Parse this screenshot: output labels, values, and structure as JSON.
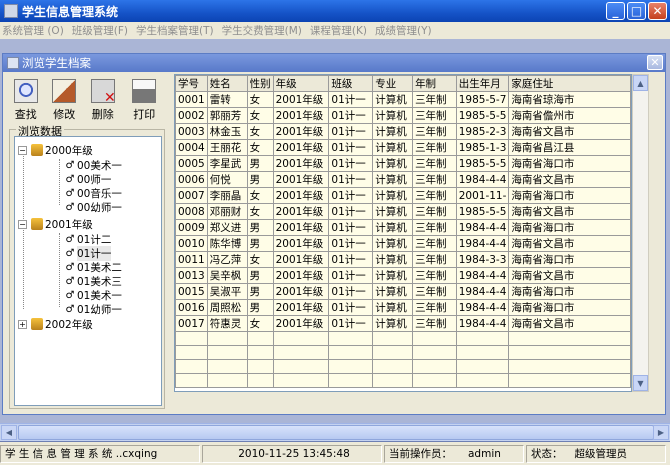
{
  "window": {
    "title": "学生信息管理系统"
  },
  "menu": [
    "系统管理 (O)",
    "班级管理(F)",
    "学生档案管理(T)",
    "学生交费管理(M)",
    "课程管理(K)",
    "成绩管理(Y)"
  ],
  "child": {
    "title": "浏览学生档案"
  },
  "toolbar": {
    "find": "查找",
    "edit": "修改",
    "delete": "删除",
    "print": "打印"
  },
  "tree": {
    "group_label": "浏览数据",
    "y2000": {
      "label": "2000年级",
      "classes": [
        "00美术一",
        "00师一",
        "00音乐一",
        "00幼师一"
      ]
    },
    "y2001": {
      "label": "2001年级",
      "classes": [
        "01计二",
        "01计一",
        "01美术二",
        "01美术三",
        "01美术一",
        "01幼师一"
      ]
    },
    "y2002": {
      "label": "2002年级"
    }
  },
  "table": {
    "headers": [
      "学号",
      "姓名",
      "性别",
      "年级",
      "班级",
      "专业",
      "年制",
      "出生年月",
      "家庭住址"
    ],
    "rows": [
      [
        "0001",
        "雷转",
        "女",
        "2001年级",
        "01计一",
        "计算机",
        "三年制",
        "1985-5-7",
        "海南省琼海市"
      ],
      [
        "0002",
        "郭丽芳",
        "女",
        "2001年级",
        "01计一",
        "计算机",
        "三年制",
        "1985-5-5",
        "海南省儋州市"
      ],
      [
        "0003",
        "林金玉",
        "女",
        "2001年级",
        "01计一",
        "计算机",
        "三年制",
        "1985-2-3",
        "海南省文昌市"
      ],
      [
        "0004",
        "王丽花",
        "女",
        "2001年级",
        "01计一",
        "计算机",
        "三年制",
        "1985-1-3",
        "海南省昌江县"
      ],
      [
        "0005",
        "李星武",
        "男",
        "2001年级",
        "01计一",
        "计算机",
        "三年制",
        "1985-5-5",
        "海南省海口市"
      ],
      [
        "0006",
        "何悦",
        "男",
        "2001年级",
        "01计一",
        "计算机",
        "三年制",
        "1984-4-4",
        "海南省文昌市"
      ],
      [
        "0007",
        "李丽晶",
        "女",
        "2001年级",
        "01计一",
        "计算机",
        "三年制",
        "2001-11-",
        "海南省海口市"
      ],
      [
        "0008",
        "邓丽财",
        "女",
        "2001年级",
        "01计一",
        "计算机",
        "三年制",
        "1985-5-5",
        "海南省文昌市"
      ],
      [
        "0009",
        "郑义进",
        "男",
        "2001年级",
        "01计一",
        "计算机",
        "三年制",
        "1984-4-4",
        "海南省海口市"
      ],
      [
        "0010",
        "陈华博",
        "男",
        "2001年级",
        "01计一",
        "计算机",
        "三年制",
        "1984-4-4",
        "海南省文昌市"
      ],
      [
        "0011",
        "冯乙萍",
        "女",
        "2001年级",
        "01计一",
        "计算机",
        "三年制",
        "1984-3-3",
        "海南省海口市"
      ],
      [
        "0013",
        "吴辛枫",
        "男",
        "2001年级",
        "01计一",
        "计算机",
        "三年制",
        "1984-4-4",
        "海南省文昌市"
      ],
      [
        "0015",
        "吴淑平",
        "男",
        "2001年级",
        "01计一",
        "计算机",
        "三年制",
        "1984-4-4",
        "海南省海口市"
      ],
      [
        "0016",
        "周照松",
        "男",
        "2001年级",
        "01计一",
        "计算机",
        "三年制",
        "1984-4-4",
        "海南省海口市"
      ],
      [
        "0017",
        "符惠灵",
        "女",
        "2001年级",
        "01计一",
        "计算机",
        "三年制",
        "1984-4-4",
        "海南省文昌市"
      ]
    ]
  },
  "status": {
    "app": "学 生 信 息 管 理 系 统 ..cxqing",
    "datetime": "2010-11-25 13:45:48",
    "operator_label": "当前操作员：",
    "operator": "admin",
    "state_label": "状态：",
    "state": "超级管理员"
  }
}
